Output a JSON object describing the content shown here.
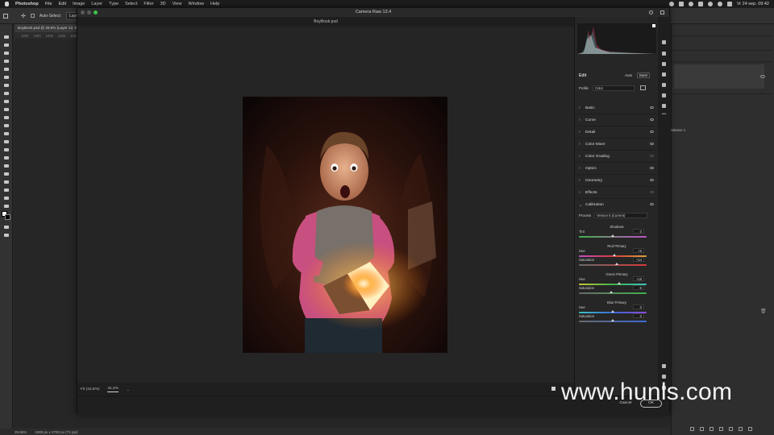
{
  "menubar": {
    "app": "Photoshop",
    "items": [
      "File",
      "Edit",
      "Image",
      "Layer",
      "Type",
      "Select",
      "Filter",
      "3D",
      "View",
      "Window",
      "Help"
    ],
    "clock": "Vr 24 sep.  09:42"
  },
  "options_bar": {
    "auto_select": "Auto-Select:",
    "layer_dropdown": "Layer"
  },
  "document_tab": {
    "title": "BoyBook.psd @ 39,9% (Layer 12, R..."
  },
  "ruler_marks": [
    "1800",
    "1900",
    "1000",
    "1000",
    "1000"
  ],
  "status_bar": {
    "zoom": "39,86%",
    "doc_info": "1985 px x 2700 px (72 ppi)"
  },
  "camera_raw": {
    "window_title": "Camera Raw 13.4",
    "file_name": "BoyBook.psd",
    "zoom_fit": "Fit (42,8%)",
    "zoom_value": "31,5%",
    "edit": {
      "title": "Edit",
      "auto_label": "Auto",
      "bw_label": "B&W",
      "profile_label": "Profile",
      "profile_value": "Color"
    },
    "sections": [
      {
        "label": "Basic",
        "dim_eye": false
      },
      {
        "label": "Curve",
        "dim_eye": false
      },
      {
        "label": "Detail",
        "dim_eye": false
      },
      {
        "label": "Color Mixer",
        "dim_eye": false
      },
      {
        "label": "Color Grading",
        "dim_eye": true
      },
      {
        "label": "Optics",
        "dim_eye": false
      },
      {
        "label": "Geometry",
        "dim_eye": false
      },
      {
        "label": "Effects",
        "dim_eye": true
      },
      {
        "label": "Calibration",
        "dim_eye": false
      }
    ],
    "calibration": {
      "process_label": "Process",
      "process_value": "Version 5 (Current)",
      "shadows_title": "Shadows",
      "tint_label": "Tint",
      "tint_value": "0",
      "red_title": "Red Primary",
      "red_hue_label": "Hue",
      "red_hue_value": "+6",
      "red_sat_label": "Saturation",
      "red_sat_value": "+14",
      "green_title": "Green Primary",
      "green_hue_label": "Hue",
      "green_hue_value": "+19",
      "green_sat_label": "Saturation",
      "green_sat_value": "-8",
      "blue_title": "Blue Primary",
      "blue_hue_label": "Hue",
      "blue_hue_value": "0",
      "blue_sat_label": "Saturation",
      "blue_sat_value": "0"
    },
    "buttons": {
      "cancel": "Cancel",
      "ok": "OK"
    }
  },
  "right_panel": {
    "layer_label": "Balance 1"
  },
  "watermark": "www.hunls.com"
}
